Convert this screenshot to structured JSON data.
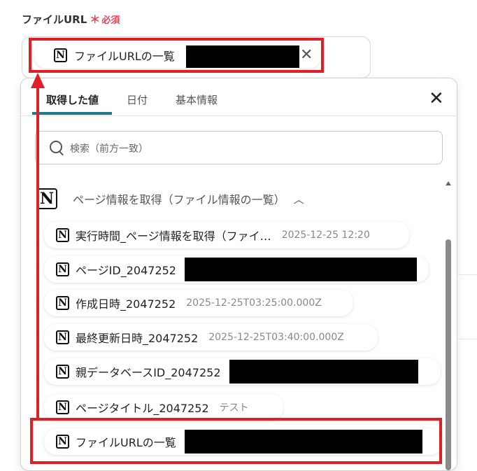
{
  "field": {
    "label": "ファイルURL",
    "required_mark": "＊",
    "required_text": "必須",
    "selected_chip": {
      "icon": "notion-icon",
      "label": "ファイルURLの一覧"
    }
  },
  "panel": {
    "tabs": [
      {
        "label": "取得した値",
        "active": true
      },
      {
        "label": "日付",
        "active": false
      },
      {
        "label": "基本情報",
        "active": false
      }
    ],
    "search_placeholder": "検索（前方一致）",
    "group": {
      "icon": "notion-icon",
      "title": "ページ情報を取得（ファイル情報の一覧）"
    },
    "items": [
      {
        "label": "実行時間_ページ情報を取得（ファイ…",
        "value": "2025-12-25 12:20"
      },
      {
        "label": "ページID_2047252",
        "value": ""
      },
      {
        "label": "作成日時_2047252",
        "value": "2025-12-25T03:25:00.000Z"
      },
      {
        "label": "最終更新日時_2047252",
        "value": "2025-12-25T03:40:00.000Z"
      },
      {
        "label": "親データベースID_2047252",
        "value": ""
      },
      {
        "label": "ページタイトル_2047252",
        "value": "テスト"
      },
      {
        "label": "ファイルURLの一覧",
        "value": ""
      }
    ]
  },
  "colors": {
    "annotation": "#e01e25",
    "tab_underline": "#1f7a8c",
    "required": "#e0455a"
  }
}
